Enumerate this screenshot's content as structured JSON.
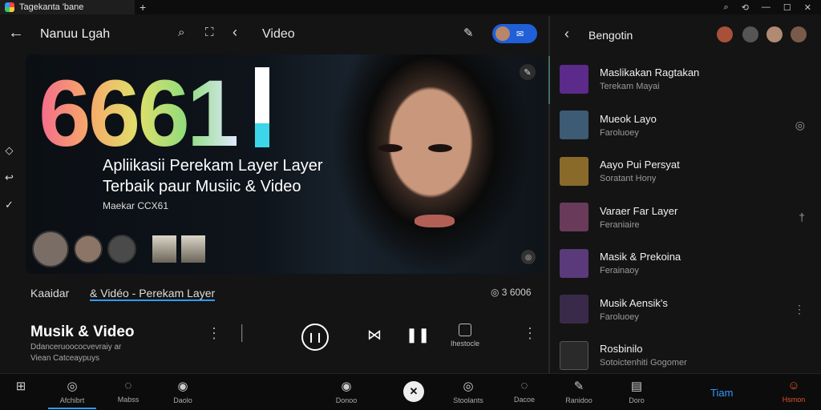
{
  "window": {
    "tab_title": "Tagekanta 'bane",
    "tab_plus": "+",
    "controls": [
      "⌕",
      "⟲",
      "—",
      "☐",
      "✕"
    ]
  },
  "header": {
    "back": "←",
    "title": "Nanuu Lgah",
    "search": "⌕",
    "scan": "⛶",
    "chevron": "‹",
    "section": "Video",
    "edit": "✎",
    "pill_icon": "✉"
  },
  "hero": {
    "big_number": "6661",
    "headline_1": "Apliikasii Perekam Layer Layer",
    "headline_2": "Terbaik paur Musiic & Video",
    "tagline": "Maekar CCX61",
    "corner_icon": "✎",
    "corner_icon_2": "◎"
  },
  "caption": {
    "left": "Kaaidar",
    "main": "& Vidéo - Perekam Layer",
    "count": "◎ 3 6006"
  },
  "left_rail": {
    "icons": [
      "◇",
      "↩",
      "✓"
    ]
  },
  "now_playing": {
    "title": "Musik & Video",
    "subtitle": "Ddanceruoococvevraiy ar",
    "subtitle2": "Viean Catceaypuys",
    "more": "⋮",
    "play": "❙❙",
    "skip": "⋈",
    "pause": "❚❚",
    "box_label": "Ihestocle",
    "more2": "⋮",
    "bar": "⏐"
  },
  "right": {
    "back": "‹",
    "title": "Bengotin",
    "items": [
      {
        "title": "Maslikakan Ragtakan",
        "sub": "Terekam Mayai",
        "color": "#5b2a8a",
        "right": ""
      },
      {
        "title": "Mueok Layo",
        "sub": "Faroluoey",
        "color": "#3d5b74",
        "right": "◎"
      },
      {
        "title": "Aayo Pui Persyat",
        "sub": "Soratant Hony",
        "color": "#8a6a2a",
        "right": ""
      },
      {
        "title": "Varaer Far Layer",
        "sub": "Feraniaire",
        "color": "#6a3a5a",
        "right": "†"
      },
      {
        "title": "Masik & Prekoina",
        "sub": "Ferainaoy",
        "color": "#5a3a7a",
        "right": ""
      },
      {
        "title": "Musik Aensik's",
        "sub": "Faroluoey",
        "color": "#3a2a4a",
        "right": "⋮"
      },
      {
        "title": "Rosbinilo",
        "sub": "Sotoictenhiti Gogomer",
        "color": "#2a2a2a",
        "right": ""
      }
    ]
  },
  "bottom_nav": [
    {
      "icon": "⊞",
      "label": ""
    },
    {
      "icon": "◎",
      "label": "Afchibrt"
    },
    {
      "icon": "◌",
      "label": "Mabss"
    },
    {
      "icon": "◉",
      "label": "Daolo"
    },
    {
      "icon": "◉",
      "label": "Donoo"
    },
    {
      "icon": "◎",
      "label": "Stoolants"
    },
    {
      "icon": "◌",
      "label": "Dacoe"
    },
    {
      "icon": "✎",
      "label": "Ranidoo"
    },
    {
      "icon": "▤",
      "label": "Doro"
    },
    {
      "icon": "☺",
      "label": "Hsmon"
    }
  ],
  "bottom_center": "✕",
  "bottom_team": "Tiam"
}
